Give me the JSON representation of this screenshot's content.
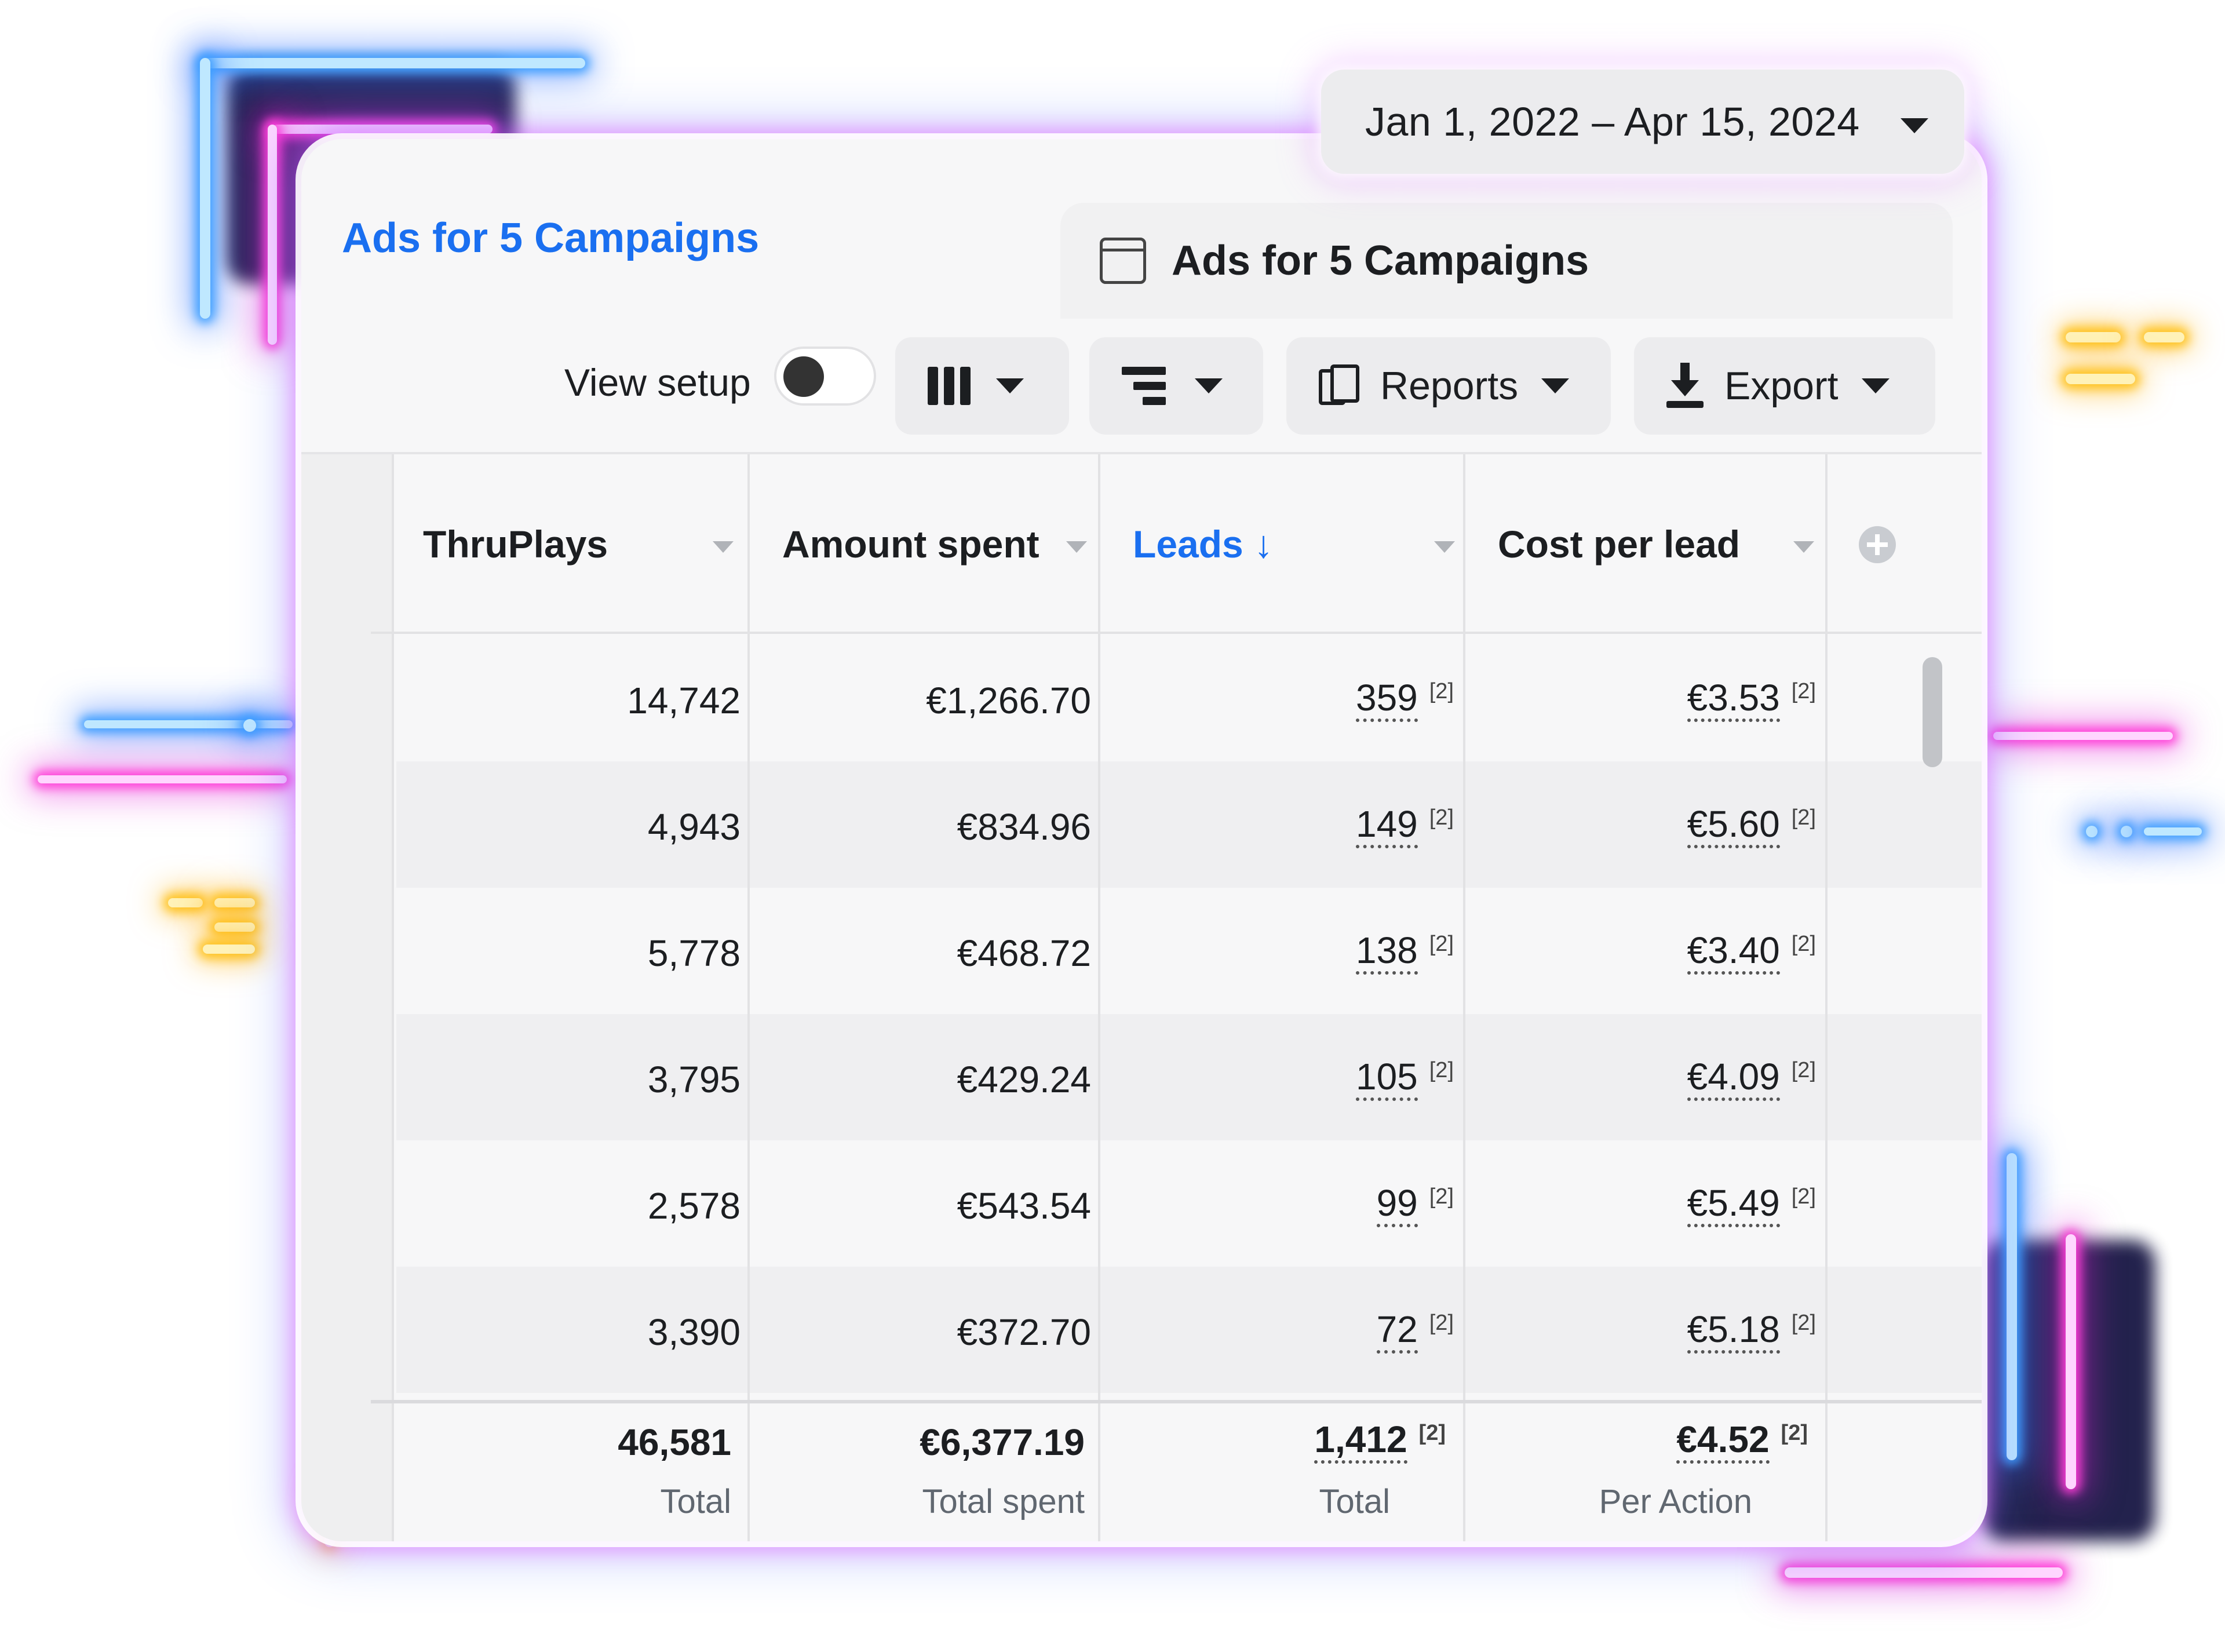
{
  "date_range": {
    "label": "Jan 1, 2022 – Apr 15, 2024"
  },
  "header": {
    "breadcrumb_title": "Ads for 5 Campaigns",
    "tab_title": "Ads for 5 Campaigns"
  },
  "toolbar": {
    "view_setup_label": "View setup",
    "view_setup_on": false,
    "reports_label": "Reports",
    "export_label": "Export"
  },
  "table": {
    "columns": [
      "ThruPlays",
      "Amount spent",
      "Leads ↓",
      "Cost per lead"
    ],
    "sorted_column": "Leads",
    "rows": [
      {
        "thruplays": "14,742",
        "amount_spent": "€1,266.70",
        "leads": "359",
        "leads_note": "[2]",
        "cost_per_lead": "€3.53",
        "cpl_note": "[2]"
      },
      {
        "thruplays": "4,943",
        "amount_spent": "€834.96",
        "leads": "149",
        "leads_note": "[2]",
        "cost_per_lead": "€5.60",
        "cpl_note": "[2]"
      },
      {
        "thruplays": "5,778",
        "amount_spent": "€468.72",
        "leads": "138",
        "leads_note": "[2]",
        "cost_per_lead": "€3.40",
        "cpl_note": "[2]"
      },
      {
        "thruplays": "3,795",
        "amount_spent": "€429.24",
        "leads": "105",
        "leads_note": "[2]",
        "cost_per_lead": "€4.09",
        "cpl_note": "[2]"
      },
      {
        "thruplays": "2,578",
        "amount_spent": "€543.54",
        "leads": "99",
        "leads_note": "[2]",
        "cost_per_lead": "€5.49",
        "cpl_note": "[2]"
      },
      {
        "thruplays": "3,390",
        "amount_spent": "€372.70",
        "leads": "72",
        "leads_note": "[2]",
        "cost_per_lead": "€5.18",
        "cpl_note": "[2]"
      }
    ],
    "totals": {
      "thruplays": "46,581",
      "thruplays_label": "Total",
      "amount_spent": "€6,377.19",
      "amount_spent_label": "Total spent",
      "leads": "1,412",
      "leads_note": "[2]",
      "leads_label": "Total",
      "cost_per_lead": "€4.52",
      "cpl_note": "[2]",
      "cost_per_lead_label": "Per Action"
    }
  },
  "colors": {
    "accent": "#1a6ff0",
    "neon_blue": "#3fa0ff",
    "neon_pink": "#ff3fd8",
    "neon_gold": "#ffc21a"
  }
}
